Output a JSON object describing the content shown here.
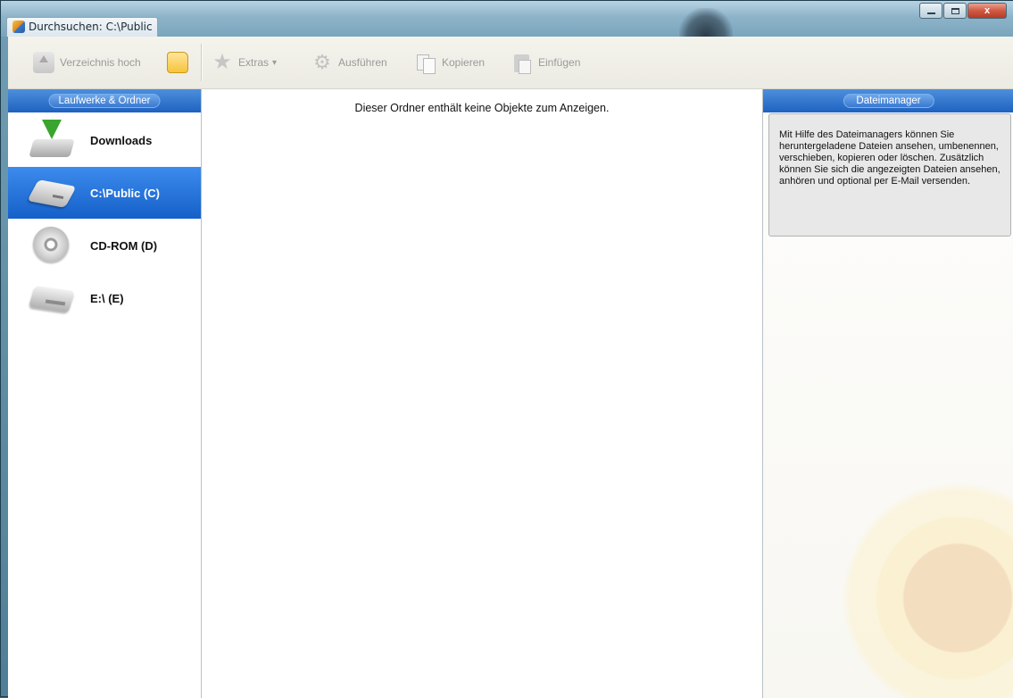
{
  "window": {
    "title": "Durchsuchen: C:\\Public",
    "buttons": {
      "minimize": "minimize",
      "maximize": "maximize",
      "close": "x"
    }
  },
  "toolbar": {
    "up": "Verzeichnis hoch",
    "extras": "Extras",
    "extras_arrow": "▾",
    "run": "Ausführen",
    "copy": "Kopieren",
    "paste": "Einfügen"
  },
  "left_panel": {
    "header": "Laufwerke & Ordner",
    "drives": [
      {
        "label": "Downloads",
        "icon": "download-icon"
      },
      {
        "label": "C:\\Public (C)",
        "icon": "hard-drive-icon",
        "selected": true
      },
      {
        "label": "CD-ROM (D)",
        "icon": "cd-rom-icon"
      },
      {
        "label": "E:\\ (E)",
        "icon": "removable-drive-icon"
      }
    ]
  },
  "center_panel": {
    "empty_message": "Dieser Ordner enthält keine Objekte zum Anzeigen."
  },
  "right_panel": {
    "header": "Dateimanager",
    "info_text": "Mit Hilfe des Dateimanagers können Sie heruntergeladene Dateien ansehen, umbenennen, verschieben, kopieren oder löschen. Zusätzlich können Sie sich die angezeigten Dateien ansehen, anhören und optional per E-Mail versenden."
  },
  "colors": {
    "accent_blue": "#1e62c0",
    "selected_blue": "#2b78de",
    "toolbar_bg": "#ecebe3",
    "info_box_bg": "#e8e8e8"
  }
}
